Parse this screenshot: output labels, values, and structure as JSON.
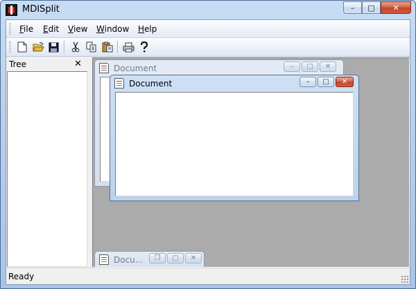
{
  "app": {
    "title": "MDISplit"
  },
  "caption_buttons": {
    "minimize": "–",
    "maximize": "□",
    "close": "✕"
  },
  "menu": {
    "items": [
      {
        "label": "File"
      },
      {
        "label": "Edit"
      },
      {
        "label": "View"
      },
      {
        "label": "Window"
      },
      {
        "label": "Help"
      }
    ]
  },
  "toolbar": {
    "buttons": [
      {
        "icon": "new-document-icon"
      },
      {
        "icon": "open-folder-icon"
      },
      {
        "icon": "save-disk-icon"
      },
      {
        "icon": "cut-scissors-icon"
      },
      {
        "icon": "copy-icon"
      },
      {
        "icon": "paste-icon"
      },
      {
        "icon": "print-icon"
      },
      {
        "icon": "help-question-icon"
      }
    ]
  },
  "tree_pane": {
    "title": "Tree",
    "close_glyph": "✕"
  },
  "documents": {
    "back": {
      "title": "Document",
      "min": "–",
      "max": "□",
      "close": "✕"
    },
    "front": {
      "title": "Document",
      "min": "–",
      "max": "□",
      "close": "✕"
    },
    "minimized": {
      "title": "Docu...",
      "restore": "❐",
      "max": "□",
      "close": "✕"
    }
  },
  "status": {
    "text": "Ready"
  },
  "colors": {
    "active_close": "#c2452a",
    "mdi_background": "#ababab"
  }
}
